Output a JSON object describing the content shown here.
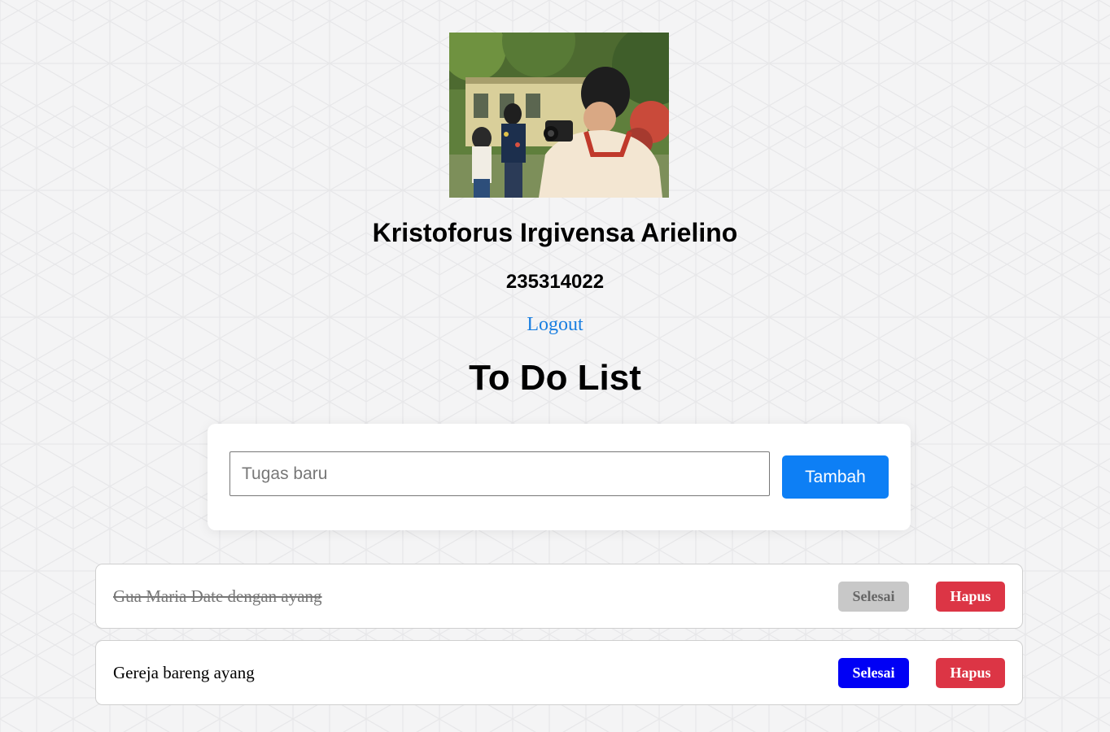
{
  "profile": {
    "name": "Kristoforus Irgivensa Arielino",
    "id": "235314022",
    "photo_alt": "profile-photo"
  },
  "logout_label": "Logout",
  "title": "To Do List",
  "add_form": {
    "placeholder": "Tugas baru",
    "value": "",
    "button_label": "Tambah"
  },
  "tasks": [
    {
      "text": "Gua Maria Date dengan ayang",
      "completed": true,
      "done_label": "Selesai",
      "delete_label": "Hapus"
    },
    {
      "text": "Gereja bareng ayang",
      "completed": false,
      "done_label": "Selesai",
      "delete_label": "Hapus"
    }
  ],
  "colors": {
    "primary_button": "#0d7ff5",
    "done_button": "#0000f5",
    "done_button_completed": "#c8c8c8",
    "delete_button": "#dc3545",
    "link": "#1a7fe0",
    "background": "#f4f4f5"
  }
}
